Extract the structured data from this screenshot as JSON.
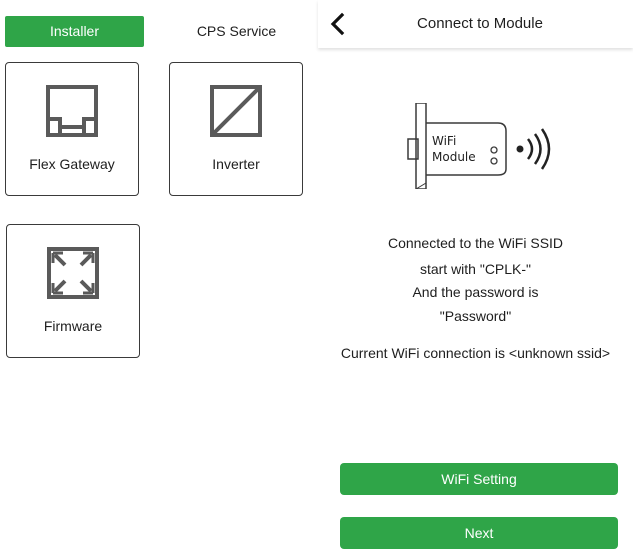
{
  "left": {
    "tabs": {
      "installer": "Installer",
      "service": "CPS Service"
    },
    "cards": {
      "flex_gateway": "Flex Gateway",
      "inverter": "Inverter",
      "firmware": "Firmware"
    }
  },
  "right": {
    "header": {
      "title": "Connect to Module"
    },
    "illustration": {
      "line1": "WiFi",
      "line2": "Module"
    },
    "message": {
      "line1": "Connected to the WiFi SSID",
      "line2": "start with \"CPLK-\"",
      "line3": "And the password is",
      "line4": "\"Password\"",
      "line5": "Current WiFi connection is <unknown ssid>"
    },
    "buttons": {
      "wifi_setting": "WiFi Setting",
      "next": "Next"
    }
  },
  "colors": {
    "accent": "#2fa548",
    "icon": "#5a5a5a",
    "text": "#1e1e1e"
  }
}
